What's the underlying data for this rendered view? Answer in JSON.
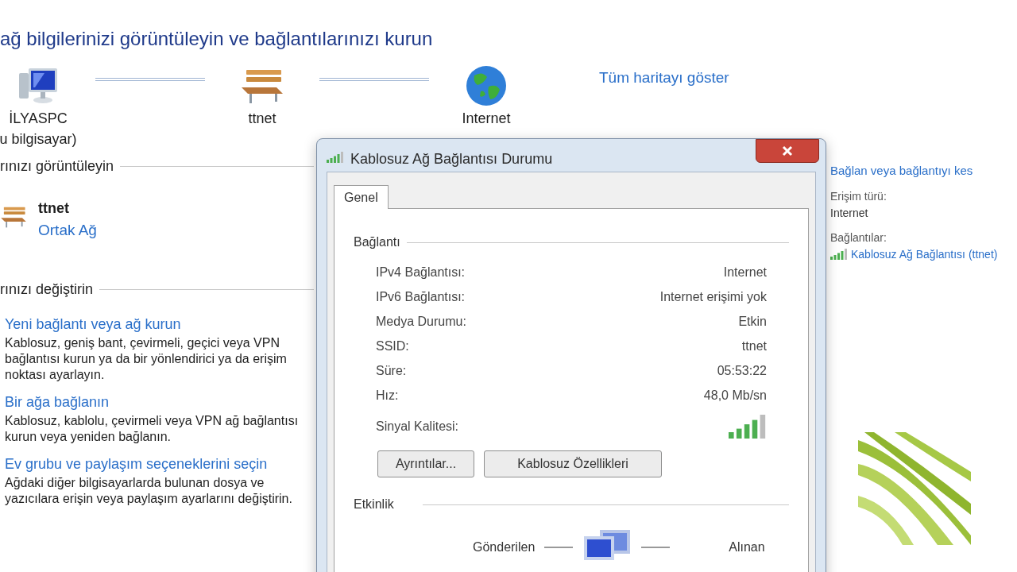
{
  "heading": "ağ bilgilerinizi görüntüleyin ve bağlantılarınızı kurun",
  "map": {
    "nodes": [
      {
        "kind": "computer",
        "label": "İLYASPC",
        "sublabel": "u bilgisayar)"
      },
      {
        "kind": "bench",
        "label": "ttnet"
      },
      {
        "kind": "globe",
        "label": "Internet"
      }
    ],
    "link": "Tüm haritayı göster"
  },
  "active_section": {
    "title": "rınızı görüntüleyin",
    "network_name": "ttnet",
    "network_type": "Ortak Ağ",
    "connect_link": "Bağlan veya bağlantıyı kes",
    "details": [
      {
        "kind": "text",
        "label": "Erişim türü:",
        "value": "Internet"
      },
      {
        "kind": "link",
        "label": "Bağlantılar:",
        "value": "Kablosuz Ağ Bağlantısı (ttnet)"
      }
    ]
  },
  "change_section": {
    "title": "rınızı değiştirin",
    "tasks": [
      {
        "title": "Yeni bağlantı veya ağ kurun",
        "description": "Kablosuz, geniş bant, çevirmeli, geçici veya VPN bağlantısı kurun ya da bir yönlendirici ya da erişim noktası ayarlayın."
      },
      {
        "title": "Bir ağa bağlanın",
        "description": "Kablosuz, kablolu, çevirmeli veya VPN ağ bağlantısı kurun veya yeniden bağlanın."
      },
      {
        "title": "Ev grubu ve paylaşım seçeneklerini seçin",
        "description": "Ağdaki diğer bilgisayarlarda bulunan dosya ve yazıcılara erişin veya paylaşım ayarlarını değiştirin."
      }
    ]
  },
  "dialog": {
    "title": "Kablosuz Ağ Bağlantısı Durumu",
    "tabs": [
      {
        "label": "Genel",
        "selected": true
      }
    ],
    "connection_group": "Bağlantı",
    "rows": [
      {
        "kind": "text",
        "label": "IPv4 Bağlantısı:",
        "value": "Internet"
      },
      {
        "kind": "text",
        "label": "IPv6 Bağlantısı:",
        "value": "Internet erişimi yok"
      },
      {
        "kind": "text",
        "label": "Medya Durumu:",
        "value": "Etkin"
      },
      {
        "kind": "text",
        "label": "SSID:",
        "value": "ttnet"
      },
      {
        "kind": "text",
        "label": "Süre:",
        "value": "05:53:22"
      },
      {
        "kind": "text",
        "label": "Hız:",
        "value": "48,0 Mb/sn"
      },
      {
        "kind": "signal",
        "label": "Sinyal Kalitesi:"
      }
    ],
    "buttons": [
      "Ayrıntılar...",
      "Kablosuz Özellikleri"
    ],
    "activity_group": "Etkinlik",
    "sent": "Gönderilen",
    "received": "Alınan"
  }
}
